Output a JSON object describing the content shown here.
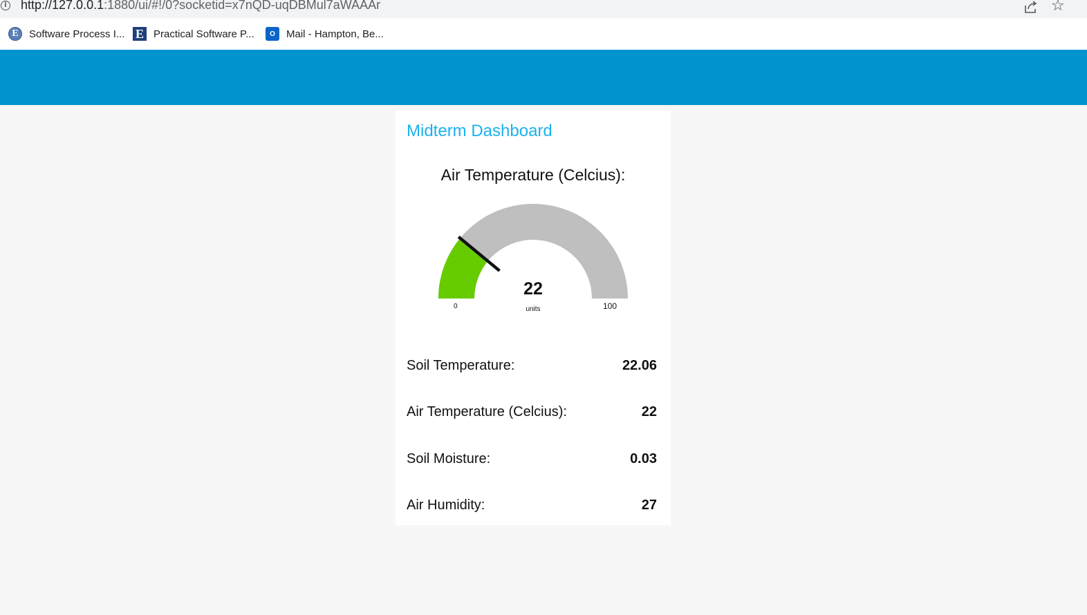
{
  "browser": {
    "url_host": "http://127.0.0.1",
    "url_rest": ":1880/ui/#!/0?socketid=x7nQD-uqDBMul7aWAAAr",
    "bookmarks": [
      {
        "label": "Software Process I...",
        "icon": "E"
      },
      {
        "label": "Practical Software P...",
        "icon": "E"
      },
      {
        "label": "Mail - Hampton, Be...",
        "icon": "O"
      }
    ]
  },
  "dashboard": {
    "title": "Midterm Dashboard",
    "gauge": {
      "title": "Air Temperature (Celcius):",
      "value": "22",
      "units": "units",
      "min": "0",
      "max": "100",
      "fill_fraction": 0.22,
      "fill_color": "#66cc00",
      "track_color": "#bfbfbf"
    },
    "readings": [
      {
        "label": "Soil Temperature:",
        "value": "22.06"
      },
      {
        "label": "Air Temperature (Celcius):",
        "value": "22"
      },
      {
        "label": "Soil Moisture:",
        "value": "0.03"
      },
      {
        "label": "Air Humidity:",
        "value": "27"
      }
    ]
  },
  "colors": {
    "header": "#0094ce",
    "title": "#1bb1ee",
    "background": "#f7f7f7"
  }
}
